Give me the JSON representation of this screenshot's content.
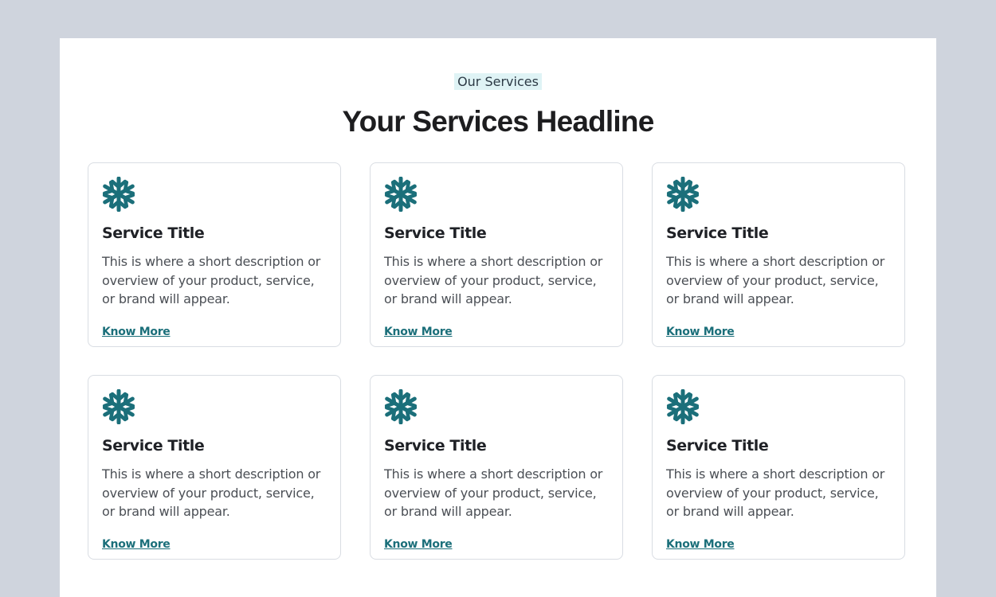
{
  "section": {
    "eyebrow": "Our Services",
    "headline": "Your Services Headline"
  },
  "colors": {
    "accent": "#1b6f7a",
    "eyebrow_bg": "#dff3f5",
    "page_bg": "#cfd4dd"
  },
  "cards": [
    {
      "icon": "snowflake-icon",
      "title": "Service Title",
      "description": "This is where a short description or overview of your product, service, or brand will appear.",
      "link": "Know More"
    },
    {
      "icon": "snowflake-icon",
      "title": "Service Title",
      "description": "This is where a short description or overview of your product, service, or brand will appear.",
      "link": "Know More"
    },
    {
      "icon": "snowflake-icon",
      "title": "Service Title",
      "description": "This is where a short description or overview of your product, service, or brand will appear.",
      "link": "Know More"
    },
    {
      "icon": "snowflake-icon",
      "title": "Service Title",
      "description": "This is where a short description or overview of your product, service, or brand will appear.",
      "link": "Know More"
    },
    {
      "icon": "snowflake-icon",
      "title": "Service Title",
      "description": "This is where a short description or overview of your product, service, or brand will appear.",
      "link": "Know More"
    },
    {
      "icon": "snowflake-icon",
      "title": "Service Title",
      "description": "This is where a short description or overview of your product, service, or brand will appear.",
      "link": "Know More"
    }
  ]
}
